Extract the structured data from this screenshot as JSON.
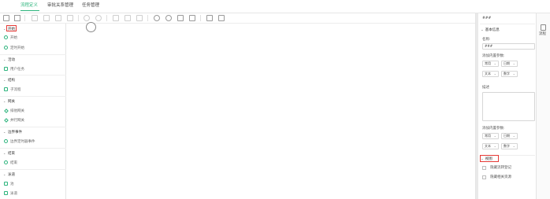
{
  "tabs": [
    {
      "label": "流程定义",
      "active": true
    },
    {
      "label": "审批关系管理",
      "active": false
    },
    {
      "label": "任务管理",
      "active": false
    }
  ],
  "colors": {
    "accent": "#2db47d",
    "highlight": "#e53935"
  },
  "toolbar": {
    "icons": [
      "open-file-icon",
      "save-icon",
      "copy-icon",
      "paste-icon",
      "cut-icon",
      "delete-icon",
      "undo-icon",
      "redo-icon",
      "align-icon",
      "distribute-icon",
      "grid-icon",
      "zoom-in-icon",
      "zoom-out-icon",
      "fit-view-icon",
      "actual-size-icon",
      "layout-icon",
      "flow-icon"
    ]
  },
  "palette": {
    "categories": [
      {
        "label": "开始",
        "items": [
          {
            "label": "开始"
          },
          {
            "label": "定时开始"
          }
        ]
      },
      {
        "label": "活动",
        "items": [
          {
            "label": "用户任务"
          }
        ]
      },
      {
        "label": "结构",
        "items": [
          {
            "label": "子流程"
          }
        ]
      },
      {
        "label": "网关",
        "items": [
          {
            "label": "排他网关"
          },
          {
            "label": "并行网关"
          }
        ]
      },
      {
        "label": "边界事件",
        "items": [
          {
            "label": "边界定时器事件"
          }
        ]
      },
      {
        "label": "结束",
        "items": [
          {
            "label": "结束"
          }
        ]
      },
      {
        "label": "泳道",
        "items": [
          {
            "label": "池"
          },
          {
            "label": "泳道"
          }
        ]
      }
    ]
  },
  "properties": {
    "title": "###",
    "basic_section": "基本信息",
    "name_label": "名称:",
    "name_value": "###",
    "vars_label_1": "添加内置参数:",
    "selects_row1": [
      "常用",
      "日期"
    ],
    "selects_row2": [
      "文本",
      "数字"
    ],
    "desc_label": "描述",
    "vars_label_2": "添加内置参数:",
    "selects_row3": [
      "常用",
      "日期"
    ],
    "selects_row4": [
      "文本",
      "数字"
    ],
    "view_section": "视图",
    "check1": "隐藏流转登记",
    "check2": "隐藏相关资源"
  },
  "strip": {
    "label": "流程"
  }
}
